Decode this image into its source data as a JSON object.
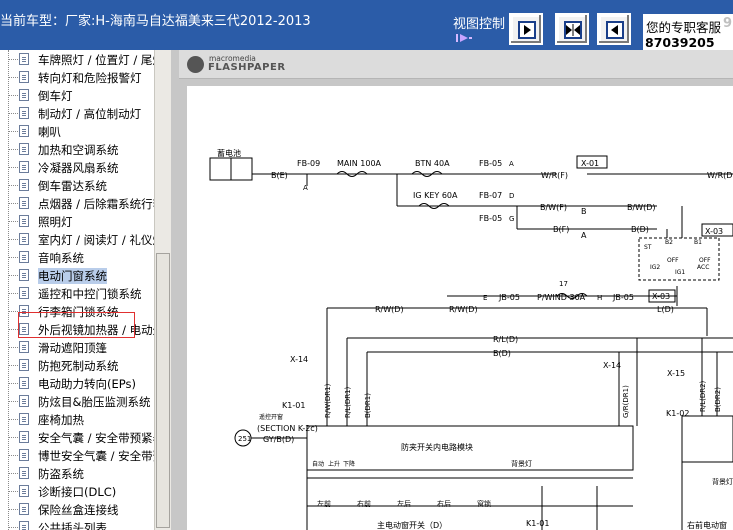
{
  "header": {
    "title": "当前车型：厂家:H-海南马自达福美来三代2012-2013",
    "view_control": "视图控制",
    "support_label": "您的专职客服",
    "support_number": "87039205",
    "support_suffix": "9"
  },
  "sidebar": {
    "selected_index": 12,
    "items": [
      {
        "label": "车牌照灯 / 位置灯 / 尾灯"
      },
      {
        "label": "转向灯和危险报警灯"
      },
      {
        "label": "倒车灯"
      },
      {
        "label": "制动灯 / 高位制动灯"
      },
      {
        "label": "喇叭"
      },
      {
        "label": "加热和空调系统"
      },
      {
        "label": "冷凝器风扇系统"
      },
      {
        "label": "倒车雷达系统"
      },
      {
        "label": "点烟器 / 后除霜系统行李"
      },
      {
        "label": "照明灯"
      },
      {
        "label": "室内灯 / 阅读灯 / 礼仪灯"
      },
      {
        "label": "音响系统"
      },
      {
        "label": "电动门窗系统"
      },
      {
        "label": "遥控和中控门锁系统"
      },
      {
        "label": "行李箱门锁系统"
      },
      {
        "label": "外后视镜加热器 / 电动外"
      },
      {
        "label": "滑动遮阳顶篷"
      },
      {
        "label": "防抱死制动系统"
      },
      {
        "label": "电动助力转向(EPs)"
      },
      {
        "label": "防炫目&胎压监测系统"
      },
      {
        "label": "座椅加热"
      },
      {
        "label": "安全气囊 / 安全带预紧器"
      },
      {
        "label": "博世安全气囊 / 安全带预"
      },
      {
        "label": "防盗系统"
      },
      {
        "label": "诊断接口(DLC)"
      },
      {
        "label": "保险丝盒连接线"
      },
      {
        "label": "公共插头列表"
      }
    ]
  },
  "viewer": {
    "brand_top": "macromedia",
    "brand_bottom": "FLASHPAPER"
  },
  "diagram": {
    "battery": "蓄电池",
    "fb09": "FB-09",
    "main": "MAIN 100A",
    "btn": "BTN 40A",
    "fb05": "FB-05",
    "be": "B(E)",
    "wrf": "W/R(F)",
    "wrd": "W/R(D)",
    "x01": "X-01",
    "igkey": "IG KEY 60A",
    "fb07": "FB-07",
    "bwf": "B/W(F)",
    "bwd": "B/W(D)",
    "bf": "B(F)",
    "bd": "B(D)",
    "b": "B",
    "a": "A",
    "x03": "X-03",
    "jb05": "JB-05",
    "pwind": "P/WIND 30A",
    "ld": "L(D)",
    "rwd": "R/W(D)",
    "rld": "R/L(D)",
    "x14": "X-14",
    "x15": "X-15",
    "k101": "K1-01",
    "k102": "K1-02",
    "wdr1": "R/W(DR1)",
    "rldr1": "R/L(DR1)",
    "bdr1": "B(DR1)",
    "grdr1": "G/R(DR1)",
    "rldr2": "R/L(DR2)",
    "bdr2": "B(DR2)",
    "section": "(SECTION K-2c)",
    "gybd": "GY/B(D)",
    "n251": "251",
    "remote": "遥控开窗",
    "module": "防夹开关内电路模块",
    "sw_names": [
      "左前",
      "右前",
      "左后",
      "右后",
      "窗锁"
    ],
    "sw_up": "上升",
    "sw_down": "下降",
    "backlight": "背景灯",
    "main_switch": "主电动窗开关（D）",
    "right_front": "右前电动窗",
    "auto": "自动",
    "ig_st": "ST",
    "ig2": "IG2",
    "ig1": "IG1",
    "off": "OFF",
    "acc": "ACC",
    "b1": "B1",
    "b2": "B2",
    "num17": "17",
    "circle_a": "A",
    "circle_d": "D",
    "circle_g": "G",
    "circle_e": "E",
    "circle_h": "H"
  }
}
